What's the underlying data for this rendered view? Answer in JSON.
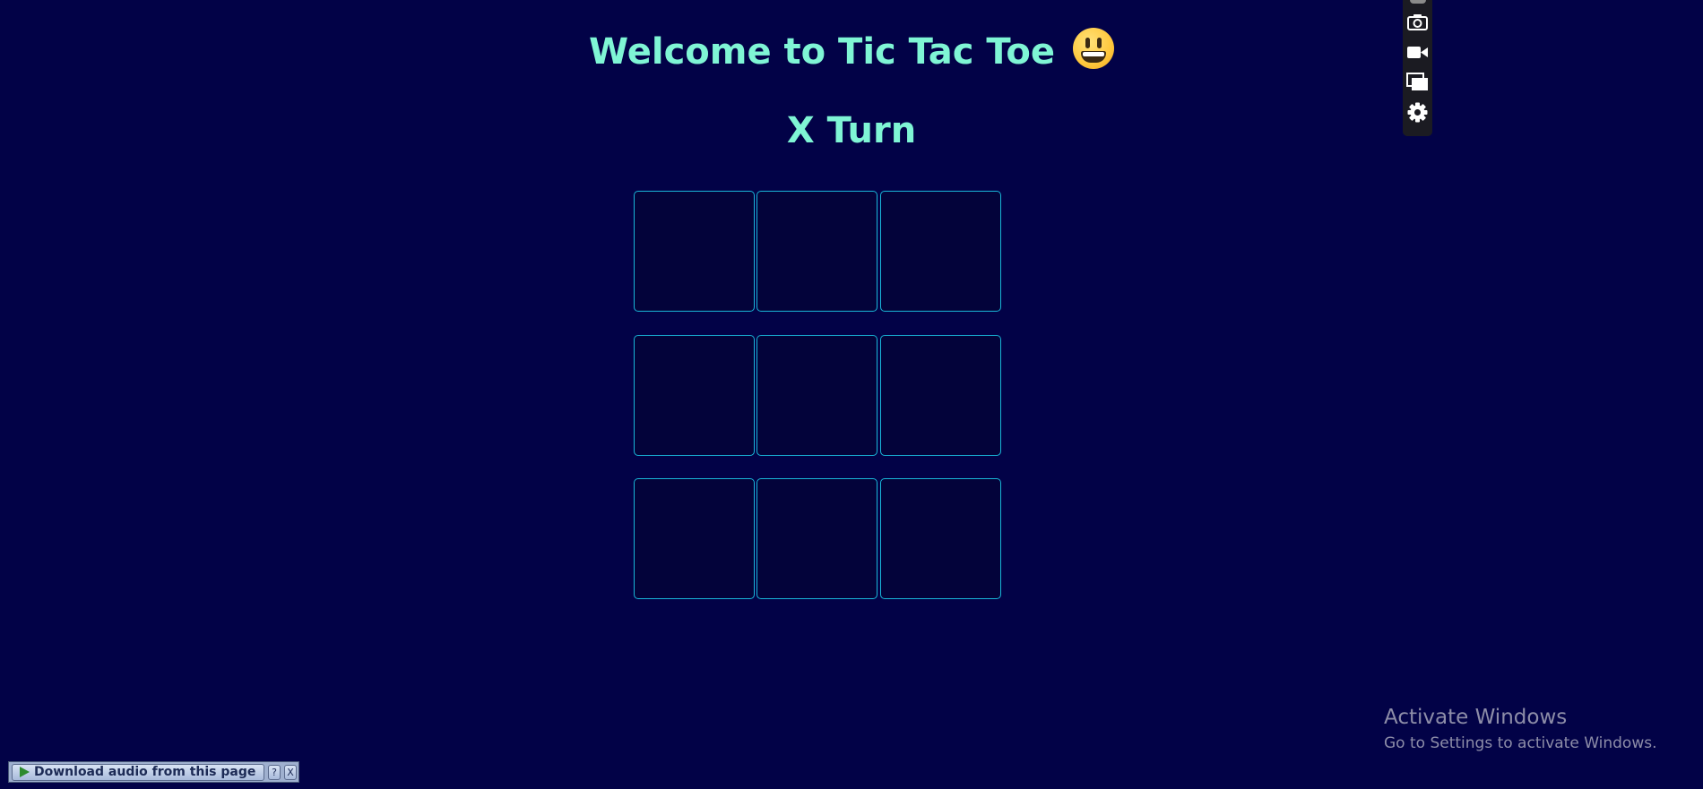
{
  "game": {
    "title": "Welcome to Tic Tac Toe",
    "title_emoji": "grinning-face",
    "turn_label": "X Turn",
    "board": [
      [
        "",
        "",
        ""
      ],
      [
        "",
        "",
        ""
      ],
      [
        "",
        "",
        ""
      ]
    ]
  },
  "toolbar": {
    "icons": [
      "camera-icon",
      "video-camera-icon",
      "windows-icon",
      "gear-icon"
    ]
  },
  "audio_bar": {
    "download_label": "Download audio from this page",
    "help_label": "?",
    "close_label": "X"
  },
  "watermark": {
    "line1": "Activate Windows",
    "line2": "Go to Settings to activate Windows."
  },
  "colors": {
    "background": "#020247",
    "heading": "#7ff5d5",
    "cell_border": "#19b6d8",
    "cell_fill": "#03033a"
  }
}
